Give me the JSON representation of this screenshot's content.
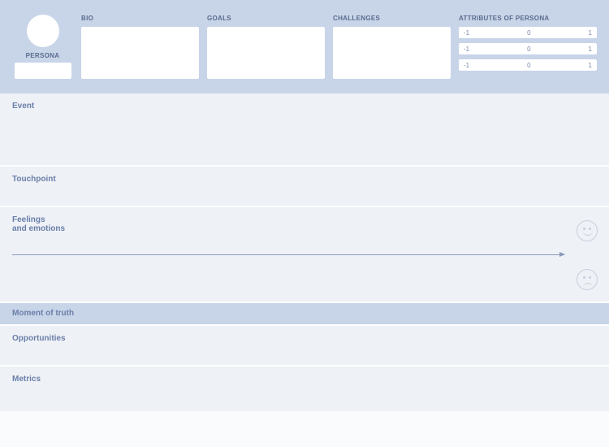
{
  "header": {
    "persona_label": "PERSONA",
    "bio_label": "BIO",
    "goals_label": "GOALS",
    "challenges_label": "CHALLENGES",
    "attributes_label": "ATTRIBUTES OF PERSONA",
    "sliders": [
      {
        "min": "-1",
        "mid": "0",
        "max": "1"
      },
      {
        "min": "-1",
        "mid": "0",
        "max": "1"
      },
      {
        "min": "-1",
        "mid": "0",
        "max": "1"
      }
    ]
  },
  "rows": {
    "event": "Event",
    "touchpoint": "Touchpoint",
    "feelings": "Feelings\nand emotions",
    "moment": "Moment of truth",
    "opportunities": "Opportunities",
    "metrics": "Metrics"
  }
}
